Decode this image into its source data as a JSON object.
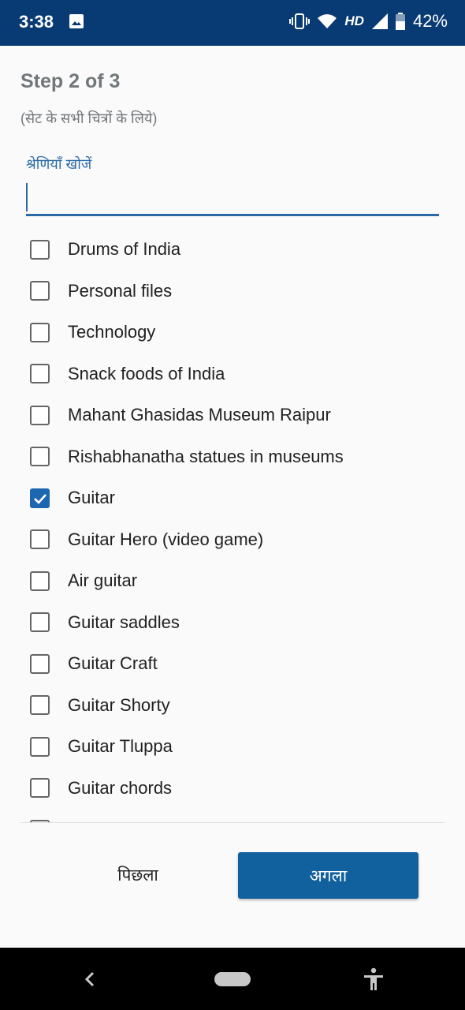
{
  "status_bar": {
    "time": "3:38",
    "network": "HD",
    "battery": "42%",
    "icons": [
      "image-icon",
      "vibrate-icon",
      "wifi-icon",
      "signal-icon",
      "battery-icon"
    ]
  },
  "wizard": {
    "step_title": "Step 2 of 3",
    "step_subtitle": "(सेट के सभी चित्रों के लिये)"
  },
  "search": {
    "label": "श्रेणियाँ खोजें",
    "value": ""
  },
  "categories": [
    {
      "label": "Drums of India",
      "checked": false
    },
    {
      "label": "Personal files",
      "checked": false
    },
    {
      "label": "Technology",
      "checked": false
    },
    {
      "label": "Snack foods of India",
      "checked": false
    },
    {
      "label": "Mahant Ghasidas Museum Raipur",
      "checked": false
    },
    {
      "label": "Rishabhanatha statues in museums",
      "checked": false
    },
    {
      "label": "Guitar",
      "checked": true
    },
    {
      "label": "Guitar Hero (video game)",
      "checked": false
    },
    {
      "label": "Air guitar",
      "checked": false
    },
    {
      "label": "Guitar saddles",
      "checked": false
    },
    {
      "label": "Guitar Craft",
      "checked": false
    },
    {
      "label": "Guitar Shorty",
      "checked": false
    },
    {
      "label": "Guitar Tluppa",
      "checked": false
    },
    {
      "label": "Guitar chords",
      "checked": false
    }
  ],
  "buttons": {
    "previous": "पिछला",
    "next": "अगला"
  },
  "colors": {
    "status_bar": "#083a73",
    "accent": "#2a6aa6",
    "next_button": "#11619f",
    "checkbox_checked": "#1d66b0"
  }
}
